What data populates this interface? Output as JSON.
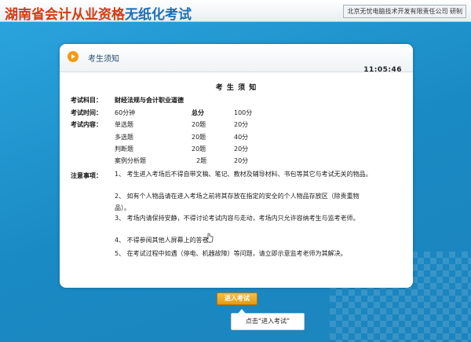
{
  "header": {
    "title_main": "湖南省会计从业资格",
    "title_sub": "无纸化考试",
    "developer": "北京无忧电脑技术开发有限责任公司 研制"
  },
  "panel": {
    "heading": "考生须知",
    "clock": "11:05:46",
    "doc_title": "考 生 须 知",
    "subject_label": "考试科目：",
    "subject_value": "财经法规与会计职业道德",
    "time_label": "考试时间：",
    "time_value": "60分钟",
    "total_label": "总分",
    "total_value": "100分",
    "content_label": "考试内容：",
    "question_types": [
      {
        "name": "单选题",
        "count": "20题",
        "score": "20分"
      },
      {
        "name": "多选题",
        "count": "20题",
        "score": "40分"
      },
      {
        "name": "判断题",
        "count": "20题",
        "score": "20分"
      },
      {
        "name": "案例分析题",
        "count": "2题",
        "score": "20分"
      }
    ],
    "notes_label": "注意事项：",
    "notes": [
      "1、 考生进入考场后不得自带文稿、笔记、教材及辅导材料、书包等其它与考试无关的物品。",
      "2、 如有个人物品请在进入考场之前将其存放在指定的安全的个人物品存放区（除贵重物品）。",
      "3、 考场内请保持安静，不得讨论考试内容与走动，考场内只允许容纳考生与监考老师。",
      "4、 不得参阅其他人屏幕上的答卷。",
      "5、 在考试过程中如遇（停电、机器故障）等问题，请立即示意监考老师为其解决。"
    ]
  },
  "enter_button": "进入考试",
  "callout": "点击“进入考试”",
  "colors": {
    "background": "#1b8fc6",
    "title_red": "#d33a12",
    "title_blue": "#1e6fb5",
    "button_orange": "#e39b12"
  }
}
